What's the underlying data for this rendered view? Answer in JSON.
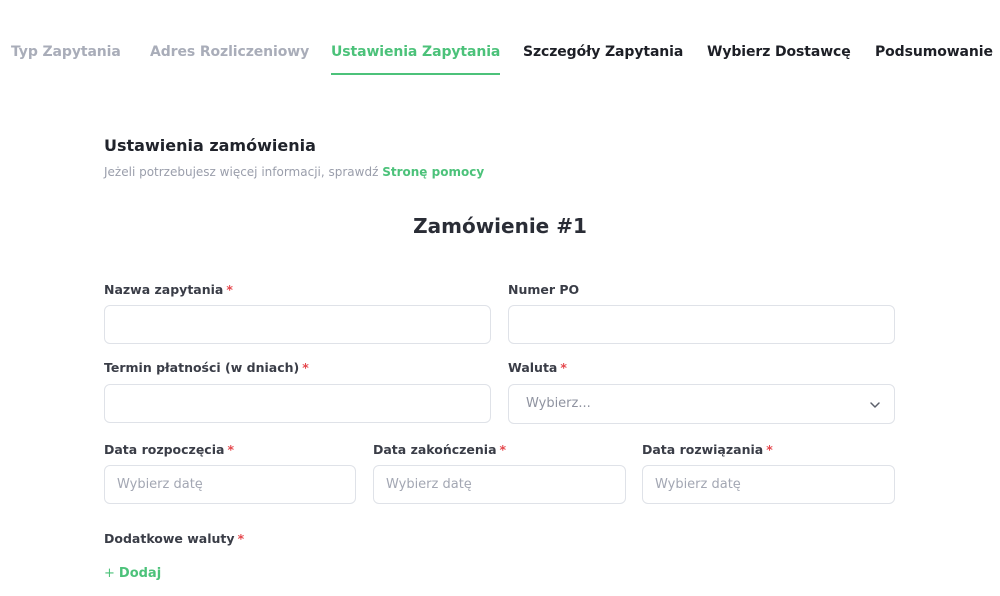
{
  "steps": [
    {
      "label": "Typ Zapytania",
      "state": "done"
    },
    {
      "label": "Adres Rozliczeniowy",
      "state": "done"
    },
    {
      "label": "Ustawienia Zapytania",
      "state": "active"
    },
    {
      "label": "Szczegóły Zapytania",
      "state": "todo"
    },
    {
      "label": "Wybierz Dostawcę",
      "state": "todo"
    },
    {
      "label": "Podsumowanie",
      "state": "todo"
    }
  ],
  "section": {
    "title": "Ustawienia zamówienia",
    "help_text": "Jeżeli potrzebujesz więcej informacji, sprawdź",
    "help_link": "Stronę pomocy"
  },
  "order_title": "Zamówienie #1",
  "required_marker": "*",
  "fields": {
    "request_name": {
      "label": "Nazwa zapytania",
      "value": "",
      "placeholder": ""
    },
    "po_number": {
      "label": "Numer PO",
      "value": "",
      "placeholder": ""
    },
    "payment_term": {
      "label": "Termin płatności (w dniach)",
      "value": "",
      "placeholder": ""
    },
    "currency": {
      "label": "Waluta",
      "selected": "Wybierz..."
    },
    "start_date": {
      "label": "Data rozpoczęcia",
      "placeholder": "Wybierz datę"
    },
    "end_date": {
      "label": "Data zakończenia",
      "placeholder": "Wybierz datę"
    },
    "termination_date": {
      "label": "Data rozwiązania",
      "placeholder": "Wybierz datę"
    },
    "additional_currencies": {
      "label": "Dodatkowe waluty",
      "add_label": "Dodaj",
      "add_icon": "+"
    }
  },
  "colors": {
    "accent": "#4cc27a",
    "required": "#e5484d",
    "tab_done": "#a9adb9",
    "tab_todo": "#1d1f26",
    "border": "#dfe2e8"
  },
  "icons": {
    "dropdown": "chevron-down-icon",
    "add": "plus-icon"
  }
}
